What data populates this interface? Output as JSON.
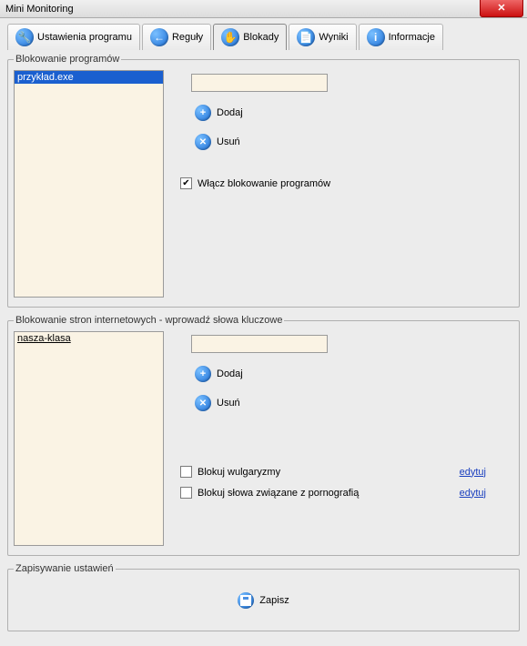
{
  "window": {
    "title": "Mini Monitoring"
  },
  "tabs": {
    "settings": "Ustawienia programu",
    "rules": "Reguły",
    "blocks": "Blokady",
    "results": "Wyniki",
    "info": "Informacje"
  },
  "programs": {
    "legend": "Blokowanie programów",
    "items": [
      "przykład.exe"
    ],
    "input": "",
    "add": "Dodaj",
    "remove": "Usuń",
    "enable_label": "Włącz blokowanie programów",
    "enable_checked": true
  },
  "sites": {
    "legend": "Blokowanie stron internetowych - wprowadź słowa kluczowe",
    "items": [
      "nasza-klasa"
    ],
    "input": "",
    "add": "Dodaj",
    "remove": "Usuń",
    "block_vulgar_label": "Blokuj wulgaryzmy",
    "block_vulgar_checked": false,
    "block_porn_label": "Blokuj słowa związane z pornografią",
    "block_porn_checked": false,
    "edit": "edytuj"
  },
  "save_section": {
    "legend": "Zapisywanie ustawień",
    "save": "Zapisz"
  }
}
